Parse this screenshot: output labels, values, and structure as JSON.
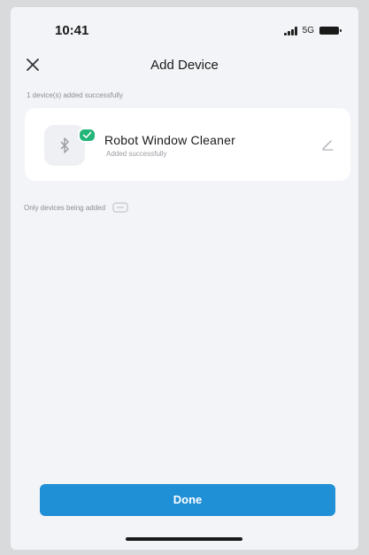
{
  "status_bar": {
    "time": "10:41",
    "network": "5G"
  },
  "header": {
    "title": "Add Device",
    "close_icon": "close-icon"
  },
  "section_hint": "1 device(s) added successfully",
  "device": {
    "name": "Robot Window Cleaner",
    "status": "Added successfully",
    "icon": "bluetooth-icon",
    "badge_icon": "check-icon",
    "edit_icon": "edit-icon"
  },
  "hint": {
    "text": "Only devices being added",
    "icon": "toggle-icon"
  },
  "done_label": "Done",
  "colors": {
    "accent": "#1f8fd6",
    "success": "#23b57a",
    "background": "#f3f4f7"
  }
}
